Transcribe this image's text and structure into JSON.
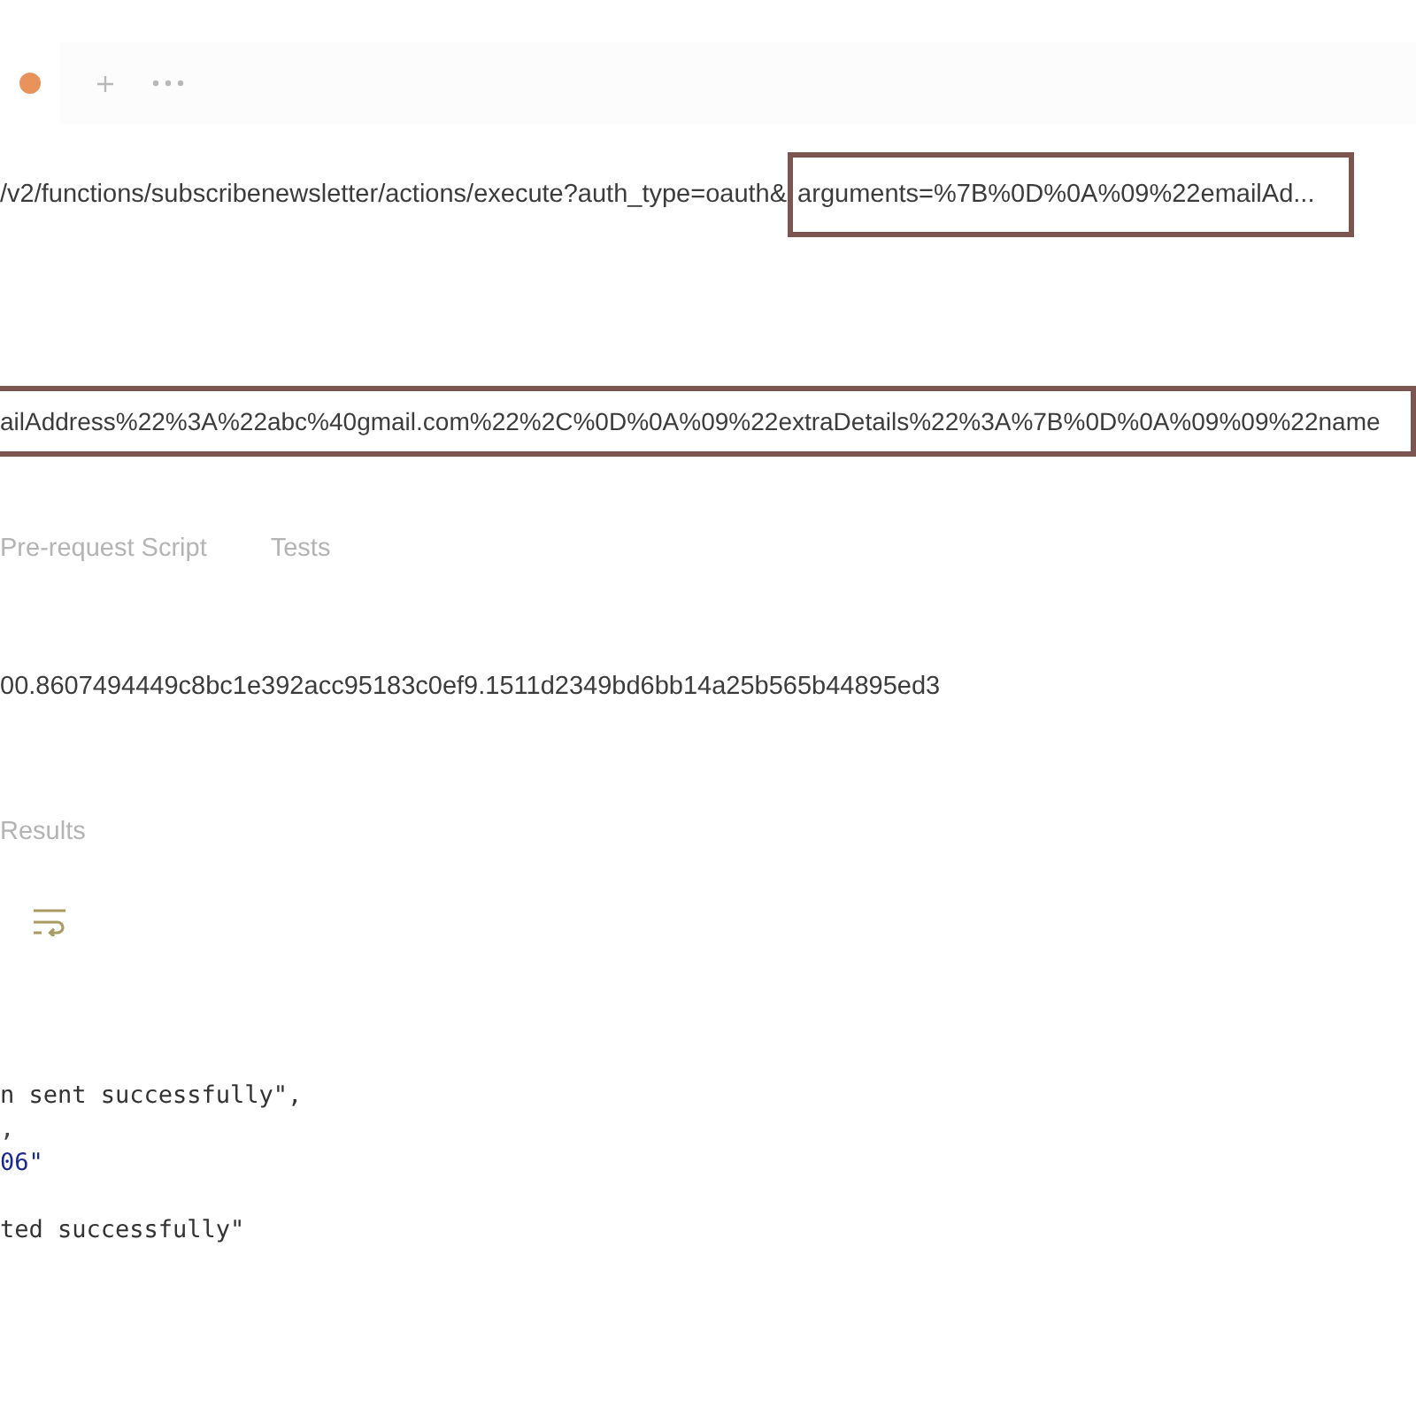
{
  "tab_bar": {
    "tabs": [
      {
        "unsaved": true
      }
    ]
  },
  "request_url": {
    "segments": [
      {
        "text": "/v2/functions/subscribenewsletter/actions/execute?auth_type=oauth&",
        "highlighted": false
      },
      {
        "text": "arguments=%7B%0D%0A%09%22emailAd...",
        "highlighted": true
      }
    ]
  },
  "param_value": {
    "text": "ailAddress%22%3A%22abc%40gmail.com%22%2C%0D%0A%09%22extraDetails%22%3A%7B%0D%0A%09%09%22name",
    "highlighted": true
  },
  "request_tabs": [
    {
      "label": "Pre-request Script",
      "selected": false
    },
    {
      "label": "Tests",
      "selected": false
    }
  ],
  "token_value": "00.8607494449c8bc1e392acc95183c0ef9.1511d2349bd6bb14a25b565b44895ed3",
  "response_tabs": [
    {
      "label": "Results",
      "selected": false
    }
  ],
  "wrap_lines": {
    "on": true
  },
  "response_body": {
    "blocks": [
      {
        "lines": [
          {
            "text": "n sent successfully\",",
            "kind": "string"
          },
          {
            "text": ",",
            "kind": "punct"
          },
          {
            "text": "06\"",
            "kind": "number"
          }
        ]
      },
      {
        "lines": [
          {
            "text": "ted successfully\"",
            "kind": "string"
          }
        ]
      }
    ]
  }
}
